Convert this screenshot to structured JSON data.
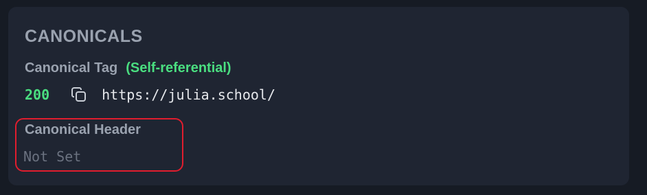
{
  "section": {
    "title": "CANONICALS"
  },
  "canonical_tag": {
    "label": "Canonical Tag",
    "note": "(Self-referential)",
    "status_code": "200",
    "copy_icon": "copy-icon",
    "url": "https://julia.school/"
  },
  "canonical_header": {
    "label": "Canonical Header",
    "value": "Not Set"
  },
  "colors": {
    "background": "#161b24",
    "card": "#1f2532",
    "label": "#9aa2af",
    "success": "#4ade80",
    "url": "#e6e8ec",
    "muted": "#6b7280",
    "highlight": "#e11d2e"
  }
}
